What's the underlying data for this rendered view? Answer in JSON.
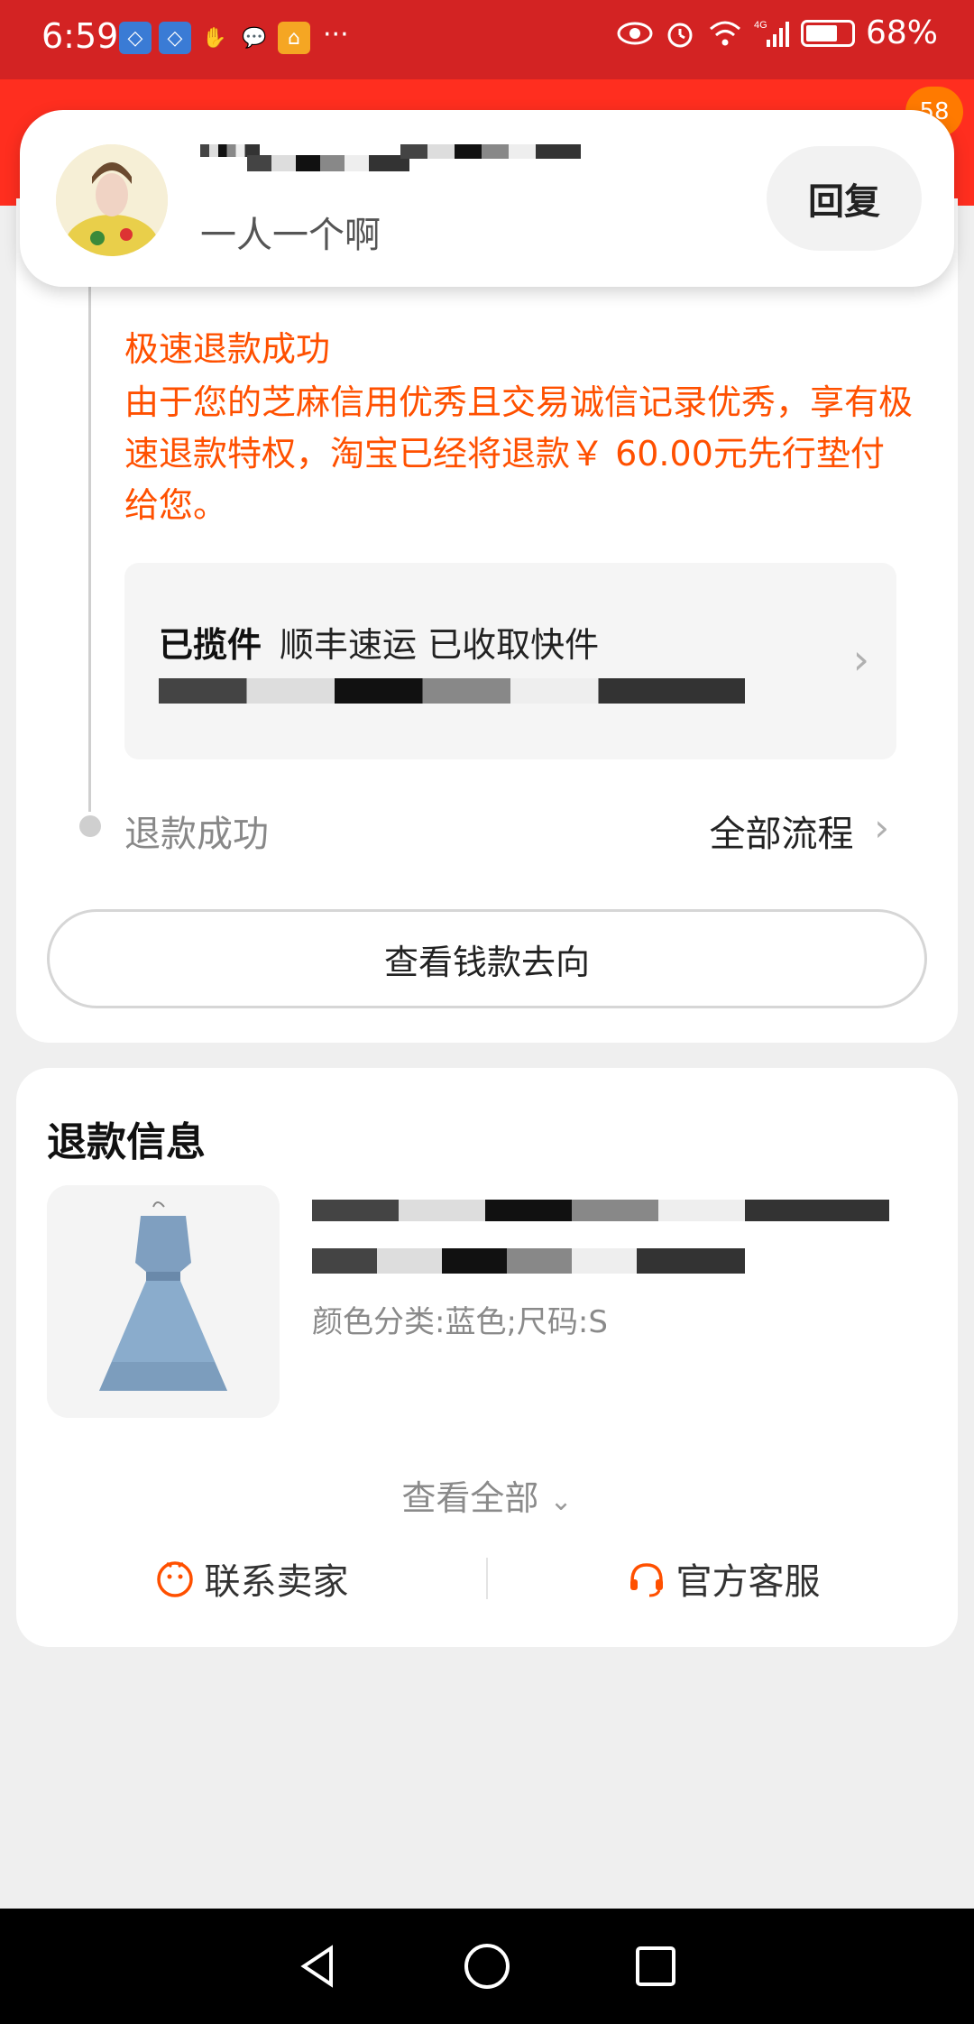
{
  "status_bar": {
    "time": "6:59",
    "battery": "68%",
    "network": "4G"
  },
  "header": {
    "badge_count": "58"
  },
  "notification": {
    "message": "一人一个啊",
    "reply_label": "回复"
  },
  "refund_progress": {
    "fast_refund_title": "极速退款成功",
    "fast_refund_desc": "由于您的芝麻信用优秀且交易诚信记录优秀，享有极速退款特权，淘宝已经将退款￥ 60.00元先行垫付给您。",
    "logistics_status": "已揽件",
    "logistics_text": "顺丰速运 已收取快件",
    "refund_success": "退款成功",
    "all_process": "全部流程",
    "money_button": "查看钱款去向"
  },
  "refund_info": {
    "title": "退款信息",
    "sku": "颜色分类:蓝色;尺码:S",
    "view_all": "查看全部",
    "contact_seller": "联系卖家",
    "official_service": "官方客服"
  },
  "colors": {
    "status_red": "#d32323",
    "brand_red": "#ff2e1f",
    "accent_orange": "#ff5000"
  },
  "icons": [
    "eye-icon",
    "alarm-icon",
    "wifi-icon",
    "signal-icon",
    "battery-icon",
    "chevron-right-icon",
    "chevron-down-icon",
    "seller-icon",
    "headset-icon",
    "back-icon",
    "home-icon",
    "recents-icon"
  ]
}
